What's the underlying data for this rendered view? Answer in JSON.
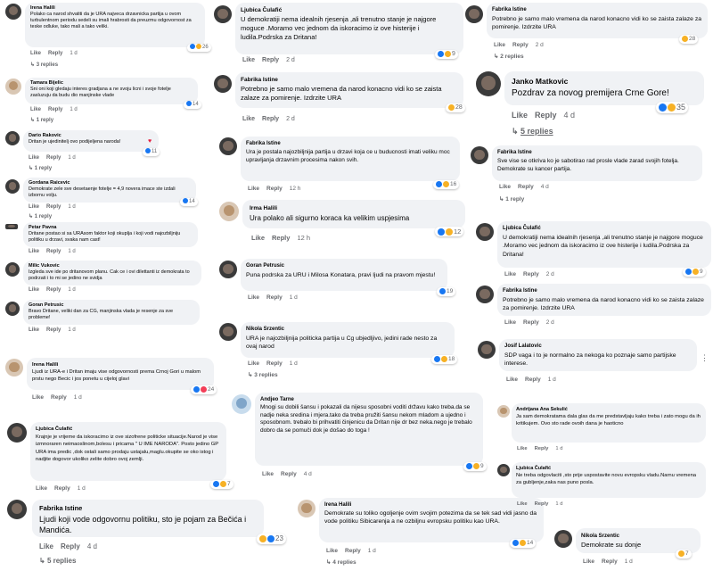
{
  "labels": {
    "like": "Like",
    "reply": "Reply"
  },
  "c1": {
    "name": "Irena Halili",
    "text": "Polako ca narod shvatiti da je URA najveca drzavnicka partija u ovom turbulentnom periodu sedeli su imali hrabrosti da preuzmu odgovornost za teske odluke, tako mali a tako veliki.",
    "time": "1 d",
    "count": "26",
    "replies": "3 replies"
  },
  "c2": {
    "name": "Tamara Bijelic",
    "text": "Sni oni koji gledaju interes gradjana a ne svoju licni i svoje fotelje zasluzuju da budu dio manjinske vlade",
    "time": "1 d",
    "count": "14",
    "replies": "1 reply"
  },
  "c3": {
    "name": "Dario Rakovic",
    "text": "Dritan je ujedinitelj ovo podijeljena naroda!",
    "time": "1 d",
    "count": "11",
    "replies": "1 reply"
  },
  "c4": {
    "name": "Gordana Raicevic",
    "text": "Demokrate zele sve desetaenje fotelje = 4,9 novera imace ste izdali izbornu volju.",
    "time": "1 d",
    "count": "14",
    "replies": "1 reply"
  },
  "c5": {
    "name": "Petar Pavna",
    "text": "Dritane postao si sa URAsom faktor koji okuplja i koji vodi najozbiljniju politiku u drzavi, svaka nam cast!",
    "time": "1 d"
  },
  "c6": {
    "name": "Milic Vukovic",
    "text": "Izgleda sve ide po dritanovom planu. Cak ce i ovi dilettanti iz demokrata to podrzati i to mi se jedino ne svidja",
    "time": "1 d"
  },
  "c7": {
    "name": "Goran Petrusic",
    "text": "Bravo Dritane, veliki dan za CG, manjinska vlada je resenje za sve probleme!",
    "time": "1 d"
  },
  "c8": {
    "name": "Irena Halili",
    "text": "Ljudi iz URA-e i Dritan imaju vise odgovornosti prema Crnoj Gori u malom prstu nego Becic i jos ponetu u cijeloj glavi",
    "time": "1 d",
    "count": "24"
  },
  "c9": {
    "name": "Ljubica Čulafić",
    "text": "Krajnje je vrijeme da iskoracimo iz ove sizofrene politicke situacije.Narod je vise izmnoraren neimaoslinom,bolesu i pricama \" U IME NARODA\". Posto jedino GP URA ima predic ,dok ostali samo prodaju ustajalu,maglu.okupite se oko istog i nadjite dogovor ukoliko zelite dobro ovoj zemlji.",
    "time": "1 d",
    "count": "7"
  },
  "c10": {
    "name": "Fabrika Istine",
    "text": "Ljudi koji vode odgovornu politiku, sto je pojam za Bečića i Mandića.",
    "time": "4 d",
    "count": "23",
    "replies": "5 replies"
  },
  "c11": {
    "name": "Ljubica Čulafić",
    "text": "U demokratiji nema idealnih rjesenja ,ali trenutno stanje je najgore moguce .Moramo vec jednom da iskoracimo iz ove histerije i ludila.Podrska za Dritana!",
    "time": "2 d",
    "count": "9"
  },
  "c12": {
    "name": "Fabrika Istine",
    "text": "Potrebno je samo malo vremena da narod konacno vidi ko se zaista zalaze za pomirenje. Izdrzite URA",
    "time": "2 d",
    "count": "28"
  },
  "c13": {
    "name": "Fabrika Istine",
    "text": "Ura je postala najozbiljnija partija u drzavi koja ce u buducnosti imati veliku moc upravljanja drzavnim procesima nakon svih.",
    "time": "12 h",
    "count": "16"
  },
  "c14": {
    "name": "Irma Halili",
    "text": "Ura polako ali sigurno koraca ka velikim uspjesima",
    "time": "12 h",
    "count": "12"
  },
  "c15": {
    "name": "Goran Petrusic",
    "text": "Puna podrska za URU i Milosa Konatara, pravi ljudi na pravom mjestu!",
    "time": "1 d",
    "count": "19"
  },
  "c16": {
    "name": "Nikola Srzentic",
    "text": "URA je najozbiljnija politicka partija u Cg ubjedljivo, jedini rade nesto za ovaj narod",
    "time": "1 d",
    "count": "18",
    "replies": "3 replies"
  },
  "c17": {
    "name": "Andjeo Tarne",
    "text": "Mnogi su dobili šansu i pokazali da nijesu sposobni voditi državu kako treba.da se nadje neka sredina i mjera.tako da treba pružiti šansu nekom mladom a ujedno i sposobnom. trebalo bi prihvatiti činjenicu da Dritan nije dr bez neka.nego je trebalo dobro da se pomuči dok je došao do toga !",
    "time": "4 d",
    "count": "9"
  },
  "c18": {
    "name": "Irena Halili",
    "text": "Demokrate su toliko ogoljenje ovim svojim potezima da se tek sad vidi jasno da vode politiku Sibicarenja a ne ozbiljnu evropsku politiku kao URA.",
    "time": "1 d",
    "count": "14",
    "replies": "4 replies"
  },
  "c19": {
    "name": "Fabrika Istine",
    "text": "Potrebno je samo malo vremena da narod konacno vidi ko se zaista zalaze za pomirenje. Izdrzite URA",
    "time": "2 d",
    "count": "28",
    "replies": "2 replies"
  },
  "c20": {
    "name": "Janko Matkovic",
    "text": "Pozdrav za novog premijera Crne Gore!",
    "time": "4 d",
    "count": "35",
    "replies": "5 replies"
  },
  "c21": {
    "name": "Fabrika Istine",
    "text": "Sve vise se otkriva ko je sabotirao rad prosle vlade zarad svojih fotelja. Demokrate su kancer partija.",
    "time": "4 d",
    "replies": "1 reply"
  },
  "c22": {
    "name": "Ljubica Čulafić",
    "text": "U demokratiji nema idealnih rjesenja ,ali trenutno stanje je najgore moguce .Moramo vec jednom da iskoracimo iz ove histerije i ludila.Podrska za Dritana!",
    "time": "2 d",
    "count": "9"
  },
  "c23": {
    "name": "Fabrika Istine",
    "text": "Potrebno je samo malo vremena da narod konacno vidi ko se zaista zalaze za pomirenje. Izdrzite URA",
    "time": "2 d"
  },
  "c24": {
    "name": "Josif Lalatovic",
    "text": "SDP vaga i to je normalno za nekoga ko poznaje samo partijske interese.",
    "time": "1 d"
  },
  "c25": {
    "name": "Andrijana Ana Sekulić",
    "text": "Ja sam demokratama dala glas da me predstavljaju kako treba i zato mogu da ih kritikujem. Ovo sto rade ovoih dana je haoticno",
    "time": "1 d"
  },
  "c26": {
    "name": "Ljubica Čulafić",
    "text": "Ne treba odgovlaciti ,sto prije uspostavite novu evropsku vladu.Narnu vremena za gubljenje,zaka nas puno posla.",
    "time": "1 d"
  },
  "c27": {
    "name": "Nikola Srzentic",
    "text": "Demokrate su donje",
    "time": "1 d",
    "count": "7"
  }
}
